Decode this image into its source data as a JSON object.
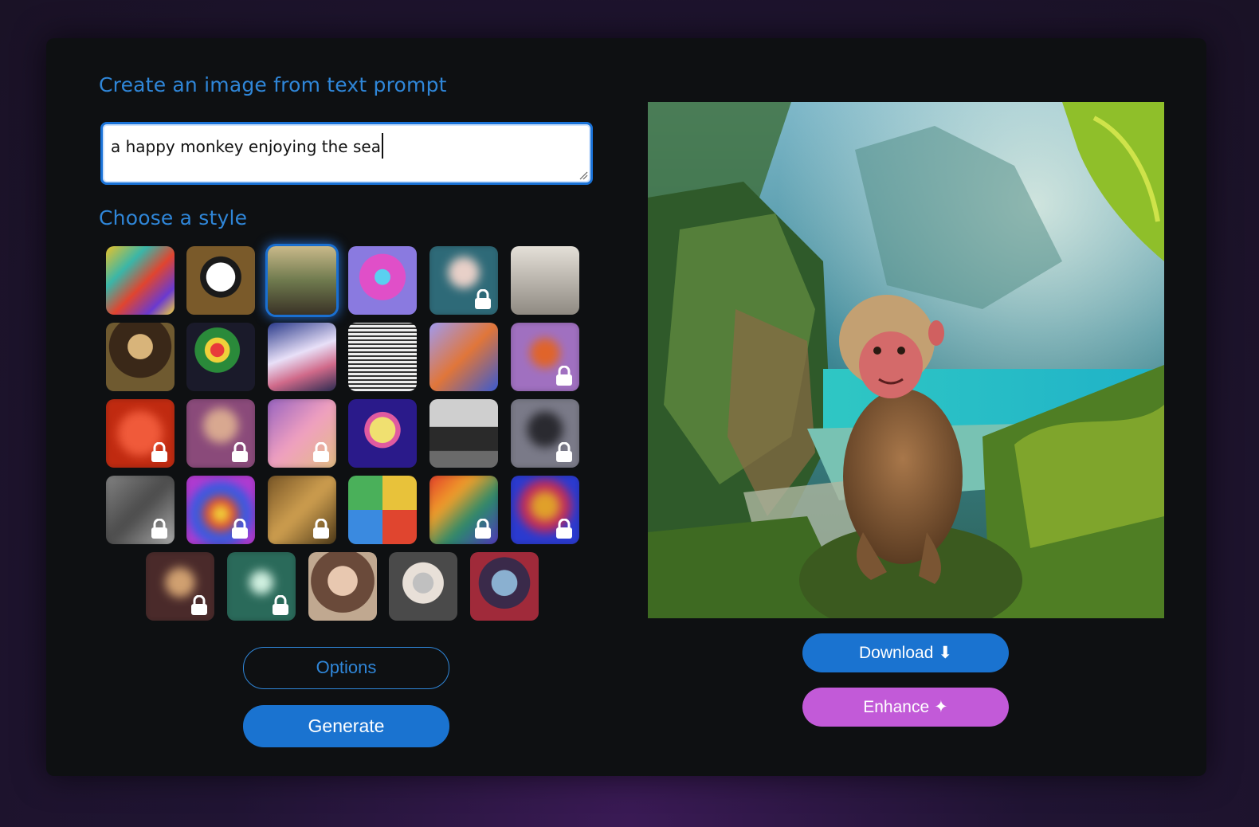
{
  "headings": {
    "create": "Create an image from text prompt",
    "style": "Choose a style"
  },
  "prompt": {
    "value": "a happy monkey enjoying the sea"
  },
  "buttons": {
    "options": "Options",
    "generate": "Generate",
    "download": "Download",
    "download_icon": "⬇",
    "enhance": "Enhance",
    "enhance_icon": "✦"
  },
  "colors": {
    "accent_blue": "#1a73d0",
    "heading_blue": "#2f86d8",
    "enhance_purple": "#c25ad8",
    "card_bg": "#0e1012"
  },
  "styles": [
    {
      "name": "abstract-paint",
      "locked": false,
      "selected": false
    },
    {
      "name": "panda-cartoon",
      "locked": false,
      "selected": false
    },
    {
      "name": "landscape-painting",
      "locked": false,
      "selected": true
    },
    {
      "name": "robot-neon",
      "locked": false,
      "selected": false
    },
    {
      "name": "portrait-teal",
      "locked": true,
      "selected": false
    },
    {
      "name": "vintage-engraving",
      "locked": false,
      "selected": false
    },
    {
      "name": "mona-lisa",
      "locked": false,
      "selected": false
    },
    {
      "name": "flower-vase",
      "locked": false,
      "selected": false
    },
    {
      "name": "ballet-dancers",
      "locked": false,
      "selected": false
    },
    {
      "name": "cup-sketch",
      "locked": false,
      "selected": false
    },
    {
      "name": "isometric-room",
      "locked": false,
      "selected": false
    },
    {
      "name": "fox-cartoon",
      "locked": true,
      "selected": false
    },
    {
      "name": "red-mask",
      "locked": true,
      "selected": false
    },
    {
      "name": "woman-portrait",
      "locked": true,
      "selected": false
    },
    {
      "name": "pastel-abstract",
      "locked": true,
      "selected": false
    },
    {
      "name": "pop-art-marilyn",
      "locked": false,
      "selected": false
    },
    {
      "name": "modern-house",
      "locked": false,
      "selected": false
    },
    {
      "name": "dark-animal",
      "locked": true,
      "selected": false
    },
    {
      "name": "grey-collage",
      "locked": true,
      "selected": false
    },
    {
      "name": "psychedelic",
      "locked": true,
      "selected": false
    },
    {
      "name": "gold-smoke",
      "locked": true,
      "selected": false
    },
    {
      "name": "icon-grid",
      "locked": false,
      "selected": false
    },
    {
      "name": "graffiti",
      "locked": true,
      "selected": false
    },
    {
      "name": "colorful-face",
      "locked": true,
      "selected": false
    },
    {
      "name": "fantasy-warrior",
      "locked": true,
      "selected": false
    },
    {
      "name": "teal-forest",
      "locked": true,
      "selected": false
    },
    {
      "name": "classic-woman",
      "locked": false,
      "selected": false
    },
    {
      "name": "watercolor-man",
      "locked": false,
      "selected": false
    },
    {
      "name": "cyber-face",
      "locked": false,
      "selected": false
    }
  ]
}
